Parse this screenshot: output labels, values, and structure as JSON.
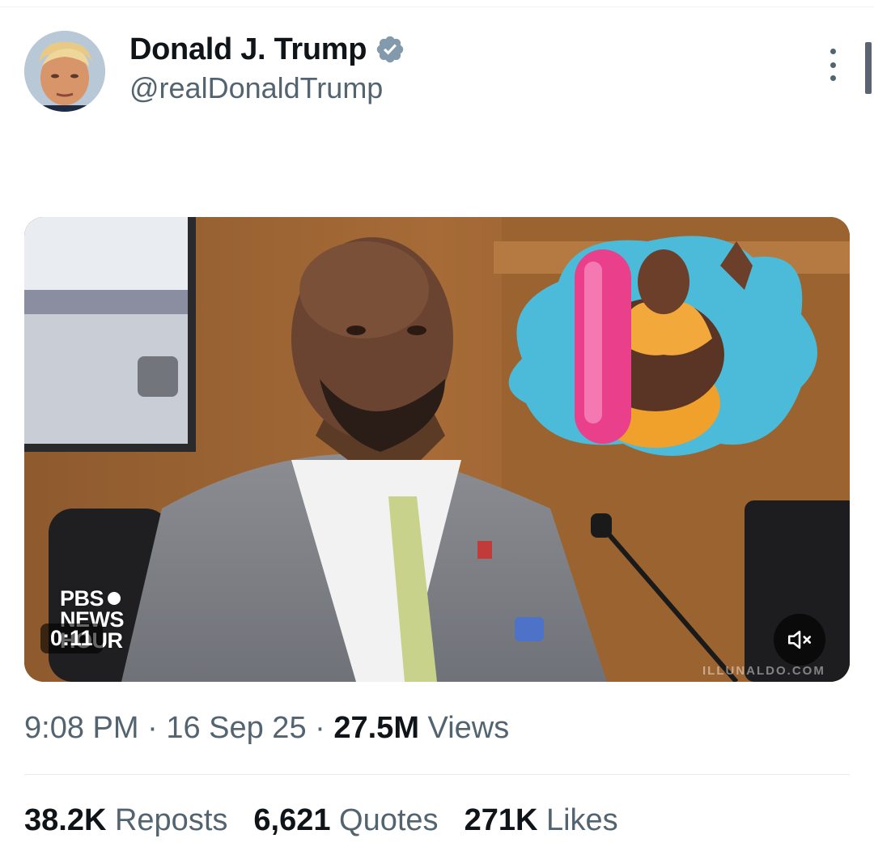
{
  "post": {
    "author": {
      "display_name": "Donald J. Trump",
      "handle": "@realDonaldTrump",
      "verified": true,
      "verified_color": "#829aab"
    },
    "media": {
      "duration": "0:11",
      "logo_line1": "PBS",
      "logo_line2": "NEWS",
      "logo_line3": "HOUR",
      "watermark": "ILLUNALDO.COM",
      "muted": true
    },
    "meta": {
      "time": "9:08 PM",
      "separator": " · ",
      "date": "16 Sep 25",
      "views_count": "27.5M",
      "views_label": "Views"
    },
    "stats": {
      "reposts_count": "38.2K",
      "reposts_label": "Reposts",
      "quotes_count": "6,621",
      "quotes_label": "Quotes",
      "likes_count": "271K",
      "likes_label": "Likes"
    }
  },
  "icons": {
    "more": "more-vertical-icon",
    "verified": "verified-badge-icon",
    "mute": "volume-muted-icon"
  }
}
